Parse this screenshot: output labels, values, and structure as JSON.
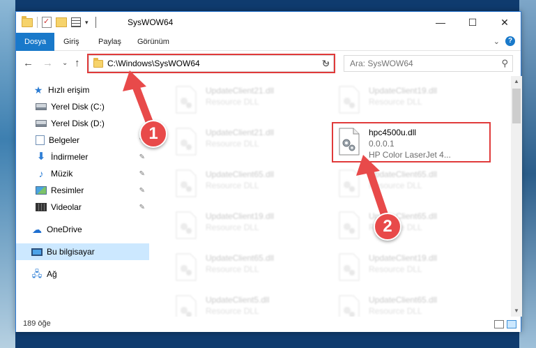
{
  "window": {
    "title": "SysWOW64",
    "controls": {
      "minimize": "—",
      "maximize": "☐",
      "close": "✕"
    }
  },
  "ribbon": {
    "tabs": [
      {
        "label": "Dosya",
        "active": true
      },
      {
        "label": "Giriş",
        "active": false
      },
      {
        "label": "Paylaş",
        "active": false
      },
      {
        "label": "Görünüm",
        "active": false
      }
    ],
    "help": "?"
  },
  "address": {
    "path": "C:\\Windows\\SysWOW64",
    "refresh_icon": "↻",
    "dropdown_icon": "⌄"
  },
  "search": {
    "placeholder": "Ara: SysWOW64",
    "icon": "⚲"
  },
  "nav_buttons": {
    "back": "←",
    "forward": "→",
    "recent": "⌄",
    "up": "↑"
  },
  "sidebar": {
    "items": [
      {
        "label": "Hızlı erişim",
        "icon": "star-icon",
        "pinned": false
      },
      {
        "label": "Yerel Disk (C:)",
        "icon": "drive-icon",
        "pinned": false
      },
      {
        "label": "Yerel Disk (D:)",
        "icon": "drive-icon",
        "pinned": false
      },
      {
        "label": "Belgeler",
        "icon": "documents-icon",
        "pinned": true
      },
      {
        "label": "İndirmeler",
        "icon": "download-icon",
        "pinned": true
      },
      {
        "label": "Müzik",
        "icon": "music-icon",
        "pinned": true
      },
      {
        "label": "Resimler",
        "icon": "pictures-icon",
        "pinned": true
      },
      {
        "label": "Videolar",
        "icon": "videos-icon",
        "pinned": true
      },
      {
        "label": "OneDrive",
        "icon": "cloud-icon",
        "pinned": false
      },
      {
        "label": "Bu bilgisayar",
        "icon": "computer-icon",
        "pinned": false,
        "selected": true
      },
      {
        "label": "Ağ",
        "icon": "network-icon",
        "pinned": false
      }
    ],
    "pin_glyph": "📌"
  },
  "files": [
    {
      "name": "UpdateClient21.dll",
      "line1": "Resource DLL",
      "line2": "",
      "faded": true
    },
    {
      "name": "UpdateClient19.dll",
      "line1": "Resource DLL",
      "line2": "",
      "faded": true
    },
    {
      "name": "UpdateClient21.dll",
      "line1": "Resource DLL",
      "line2": "",
      "faded": true
    },
    {
      "name": "hpc4500u.dll",
      "line1": "0.0.0.1",
      "line2": "HP Color LaserJet 4...",
      "faded": false
    },
    {
      "name": "UpdateClient65.dll",
      "line1": "Resource DLL",
      "line2": "",
      "faded": true
    },
    {
      "name": "UpdateClient65.dll",
      "line1": "Resource DLL",
      "line2": "",
      "faded": true
    },
    {
      "name": "UpdateClient19.dll",
      "line1": "Resource DLL",
      "line2": "",
      "faded": true
    },
    {
      "name": "UpdateClient65.dll",
      "line1": "Resource DLL",
      "line2": "",
      "faded": true
    },
    {
      "name": "UpdateClient65.dll",
      "line1": "Resource DLL",
      "line2": "",
      "faded": true
    },
    {
      "name": "UpdateClient19.dll",
      "line1": "Resource DLL",
      "line2": "",
      "faded": true
    },
    {
      "name": "UpdateClient5.dll",
      "line1": "Resource DLL",
      "line2": "",
      "faded": true
    },
    {
      "name": "UpdateClient65.dll",
      "line1": "Resource DLL",
      "line2": "",
      "faded": true
    }
  ],
  "status": {
    "item_count": "189 öğe"
  },
  "annotations": [
    {
      "number": "1",
      "color": "#e84a4a"
    },
    {
      "number": "2",
      "color": "#e84a4a"
    }
  ],
  "colors": {
    "accent": "#1979ca",
    "highlight_box": "#e03a3a",
    "selected_nav": "#cce8ff"
  }
}
